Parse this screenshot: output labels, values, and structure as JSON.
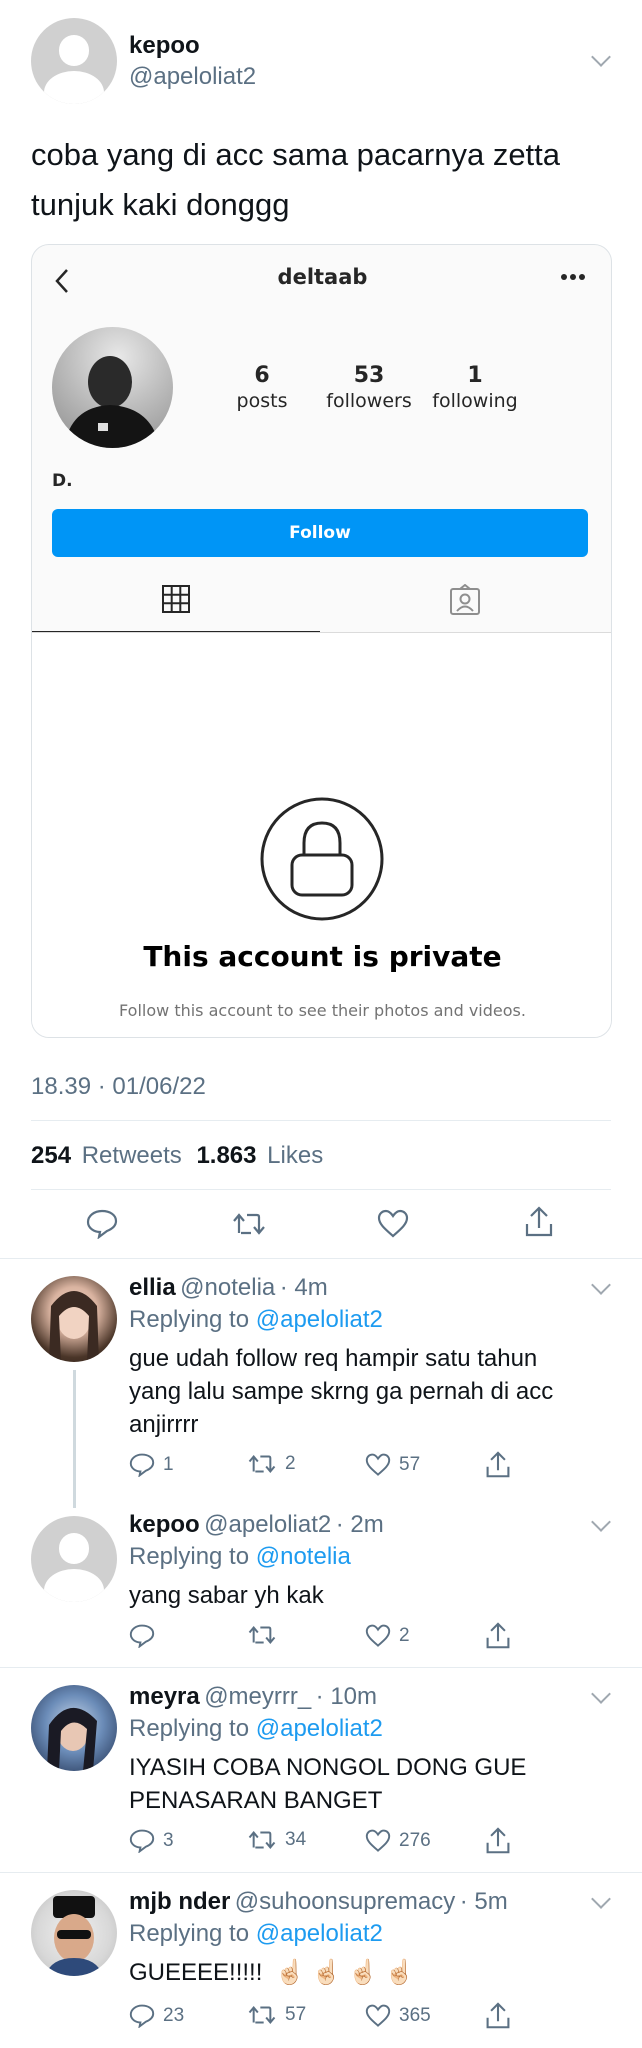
{
  "tweet": {
    "author_name": "kepoo",
    "author_handle": "@apeloliat2",
    "text_line1": "coba yang di acc sama pacarnya zetta",
    "text_line2": "tunjuk kaki donggg",
    "timestamp": "18.39 · 01/06/22",
    "retweets_count": "254",
    "retweets_label": "Retweets",
    "likes_count": "1.863",
    "likes_label": "Likes"
  },
  "instagram": {
    "username": "deltaab",
    "posts_count": "6",
    "posts_label": "posts",
    "followers_count": "53",
    "followers_label": "followers",
    "following_count": "1",
    "following_label": "following",
    "display_name": "D.",
    "follow_button": "Follow",
    "private_title": "This account is private",
    "private_subtitle": "Follow this account to see their photos and videos.",
    "accent_color": "#0095f6"
  },
  "replies": [
    {
      "name": "ellia",
      "handle": "@notelia",
      "time": "· 4m",
      "replying_prefix": "Replying to",
      "replying_to": "@apeloliat2",
      "line1": "gue udah follow req hampir satu tahun",
      "line2": "yang lalu sampe skrng ga pernah di acc",
      "line3": "anjirrrr",
      "replies": "1",
      "retweets": "2",
      "likes": "57"
    },
    {
      "name": "kepoo",
      "handle": "@apeloliat2",
      "time": "· 2m",
      "replying_prefix": "Replying to",
      "replying_to": "@notelia",
      "line1": "yang sabar yh kak",
      "likes": "2"
    },
    {
      "name": "meyra",
      "handle": "@meyrrr_",
      "time": "· 10m",
      "replying_prefix": "Replying to",
      "replying_to": "@apeloliat2",
      "line1": "IYASIH COBA NONGOL DONG GUE",
      "line2": "PENASARAN BANGET",
      "replies": "3",
      "retweets": "34",
      "likes": "276"
    },
    {
      "name": "mjb nder",
      "handle": "@suhoonsupremacy",
      "time": "· 5m",
      "replying_prefix": "Replying to",
      "replying_to": "@apeloliat2",
      "line1": "GUEEEE!!!!!",
      "emoji": "☝🏻 ☝🏻 ☝🏻 ☝🏻",
      "replies": "23",
      "retweets": "57",
      "likes": "365"
    }
  ]
}
